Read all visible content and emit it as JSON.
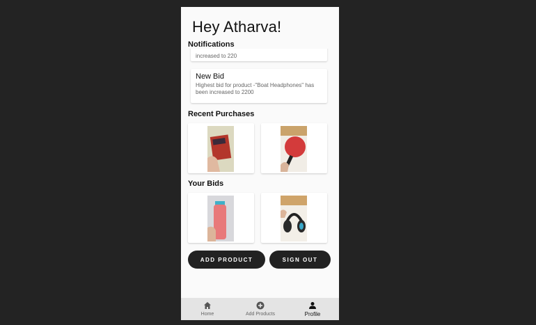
{
  "greeting": "Hey Atharva!",
  "notifications": {
    "title": "Notifications",
    "items": [
      {
        "title": "",
        "body": "increased to 220"
      },
      {
        "title": "New Bid",
        "body": "Highest bid for product -\"Boat Headphones\" has been increased to 2200"
      }
    ]
  },
  "recent_purchases": {
    "title": "Recent Purchases",
    "items": [
      {
        "name": "book-photo"
      },
      {
        "name": "table-tennis-racket-photo"
      }
    ]
  },
  "your_bids": {
    "title": "Your Bids",
    "items": [
      {
        "name": "water-bottle-photo"
      },
      {
        "name": "headphones-photo"
      }
    ]
  },
  "actions": {
    "add_product": "ADD PRODUCT",
    "sign_out": "SIGN OUT"
  },
  "nav": {
    "home": "Home",
    "add_products": "Add Products",
    "profile": "Profile",
    "active": "profile"
  },
  "icons": {
    "home": "home-icon",
    "add": "add-circle-icon",
    "profile": "person-icon"
  },
  "colors": {
    "background": "#232323",
    "screen": "#fafafa",
    "button": "#222222",
    "nav": "#e4e4e4"
  }
}
